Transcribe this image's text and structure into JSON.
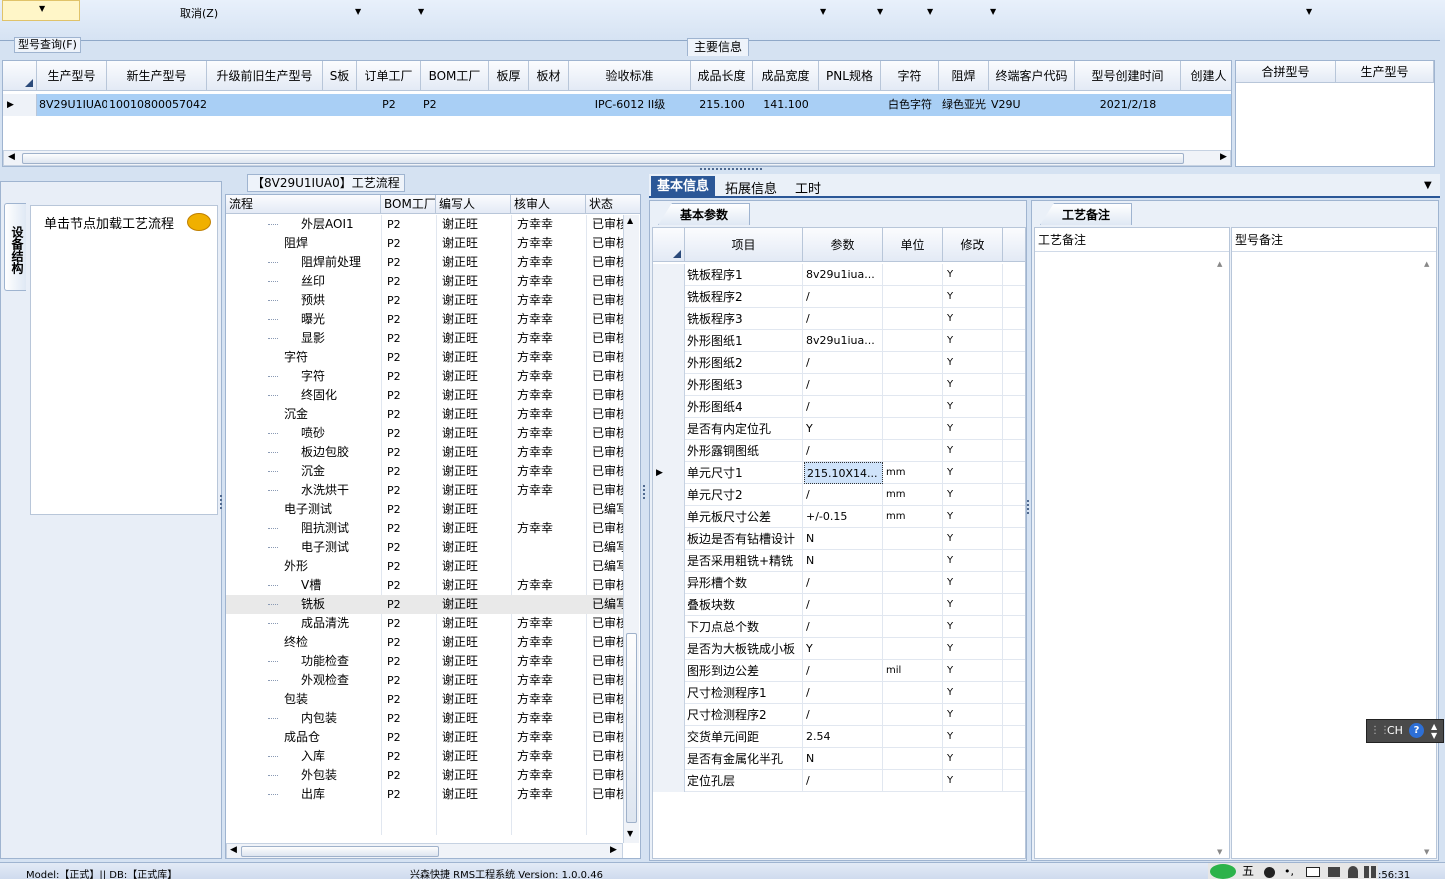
{
  "menu": {
    "cancel_label": "取消(Z)"
  },
  "top_panel": {
    "title": "型号查询(F)",
    "main_tab": "主要信息"
  },
  "model_table": {
    "headers": [
      "生产型号",
      "新生产型号",
      "升级前旧生产型号",
      "S板",
      "订单工厂",
      "BOM工厂",
      "板厚",
      "板材",
      "验收标准",
      "成品长度",
      "成品宽度",
      "PNL规格",
      "字符",
      "阻焊",
      "终端客户代码",
      "型号创建时间",
      "创建人"
    ],
    "row": [
      "8V29U1IUA0",
      "10010800057042",
      "",
      "",
      "P2",
      "P2",
      "",
      "",
      "IPC-6012 II级",
      "215.100",
      "141.100",
      "",
      "白色字符",
      "绿色亚光",
      "V29U",
      "2021/2/18",
      ""
    ]
  },
  "side_table": {
    "headers": [
      "合拼型号",
      "生产型号"
    ]
  },
  "left_panel": {
    "vertical_tab": "设备结构",
    "hint": "单击节点加载工艺流程"
  },
  "flow_panel": {
    "title": "【8V29U1IUA0】工艺流程",
    "headers": [
      "流程",
      "BOM工厂",
      "编写人",
      "核审人",
      "状态"
    ],
    "rows": [
      {
        "level": 2,
        "type": "doc",
        "name": "外层AOI1",
        "bom": "P2",
        "writer": "谢正旺",
        "reviewer": "方幸幸",
        "status": "已审核"
      },
      {
        "level": 1,
        "type": "folder",
        "name": "阻焊",
        "bom": "P2",
        "writer": "谢正旺",
        "reviewer": "方幸幸",
        "status": "已审核"
      },
      {
        "level": 2,
        "type": "doc",
        "name": "阻焊前处理",
        "bom": "P2",
        "writer": "谢正旺",
        "reviewer": "方幸幸",
        "status": "已审核"
      },
      {
        "level": 2,
        "type": "doc",
        "name": "丝印",
        "bom": "P2",
        "writer": "谢正旺",
        "reviewer": "方幸幸",
        "status": "已审核"
      },
      {
        "level": 2,
        "type": "doc",
        "name": "预烘",
        "bom": "P2",
        "writer": "谢正旺",
        "reviewer": "方幸幸",
        "status": "已审核"
      },
      {
        "level": 2,
        "type": "doc",
        "name": "曝光",
        "bom": "P2",
        "writer": "谢正旺",
        "reviewer": "方幸幸",
        "status": "已审核"
      },
      {
        "level": 2,
        "type": "doc",
        "name": "显影",
        "bom": "P2",
        "writer": "谢正旺",
        "reviewer": "方幸幸",
        "status": "已审核"
      },
      {
        "level": 1,
        "type": "folder",
        "name": "字符",
        "bom": "P2",
        "writer": "谢正旺",
        "reviewer": "方幸幸",
        "status": "已审核"
      },
      {
        "level": 2,
        "type": "doc",
        "name": "字符",
        "bom": "P2",
        "writer": "谢正旺",
        "reviewer": "方幸幸",
        "status": "已审核"
      },
      {
        "level": 2,
        "type": "doc",
        "name": "终固化",
        "bom": "P2",
        "writer": "谢正旺",
        "reviewer": "方幸幸",
        "status": "已审核"
      },
      {
        "level": 1,
        "type": "folder",
        "name": "沉金",
        "bom": "P2",
        "writer": "谢正旺",
        "reviewer": "方幸幸",
        "status": "已审核"
      },
      {
        "level": 2,
        "type": "doc",
        "name": "喷砂",
        "bom": "P2",
        "writer": "谢正旺",
        "reviewer": "方幸幸",
        "status": "已审核"
      },
      {
        "level": 2,
        "type": "doc",
        "name": "板边包胶",
        "bom": "P2",
        "writer": "谢正旺",
        "reviewer": "方幸幸",
        "status": "已审核"
      },
      {
        "level": 2,
        "type": "doc",
        "name": "沉金",
        "bom": "P2",
        "writer": "谢正旺",
        "reviewer": "方幸幸",
        "status": "已审核"
      },
      {
        "level": 2,
        "type": "doc",
        "name": "水洗烘干",
        "bom": "P2",
        "writer": "谢正旺",
        "reviewer": "方幸幸",
        "status": "已审核"
      },
      {
        "level": 1,
        "type": "folder",
        "name": "电子测试",
        "bom": "P2",
        "writer": "谢正旺",
        "reviewer": "",
        "status": "已编写"
      },
      {
        "level": 2,
        "type": "doc",
        "name": "阻抗测试",
        "bom": "P2",
        "writer": "谢正旺",
        "reviewer": "方幸幸",
        "status": "已审核"
      },
      {
        "level": 2,
        "type": "doc",
        "name": "电子测试",
        "bom": "P2",
        "writer": "谢正旺",
        "reviewer": "",
        "status": "已编写"
      },
      {
        "level": 1,
        "type": "folder",
        "name": "外形",
        "bom": "P2",
        "writer": "谢正旺",
        "reviewer": "",
        "status": "已编写"
      },
      {
        "level": 2,
        "type": "doc",
        "name": "V槽",
        "bom": "P2",
        "writer": "谢正旺",
        "reviewer": "方幸幸",
        "status": "已审核"
      },
      {
        "level": 2,
        "type": "doc",
        "name": "铣板",
        "bom": "P2",
        "writer": "谢正旺",
        "reviewer": "",
        "status": "已编写",
        "selected": true
      },
      {
        "level": 2,
        "type": "doc",
        "name": "成品清洗",
        "bom": "P2",
        "writer": "谢正旺",
        "reviewer": "方幸幸",
        "status": "已审核"
      },
      {
        "level": 1,
        "type": "folder",
        "name": "终检",
        "bom": "P2",
        "writer": "谢正旺",
        "reviewer": "方幸幸",
        "status": "已审核"
      },
      {
        "level": 2,
        "type": "doc",
        "name": "功能检查",
        "bom": "P2",
        "writer": "谢正旺",
        "reviewer": "方幸幸",
        "status": "已审核"
      },
      {
        "level": 2,
        "type": "doc",
        "name": "外观检查",
        "bom": "P2",
        "writer": "谢正旺",
        "reviewer": "方幸幸",
        "status": "已审核"
      },
      {
        "level": 1,
        "type": "folder",
        "name": "包装",
        "bom": "P2",
        "writer": "谢正旺",
        "reviewer": "方幸幸",
        "status": "已审核"
      },
      {
        "level": 2,
        "type": "doc",
        "name": "内包装",
        "bom": "P2",
        "writer": "谢正旺",
        "reviewer": "方幸幸",
        "status": "已审核"
      },
      {
        "level": 1,
        "type": "folder",
        "name": "成品仓",
        "bom": "P2",
        "writer": "谢正旺",
        "reviewer": "方幸幸",
        "status": "已审核"
      },
      {
        "level": 2,
        "type": "doc",
        "name": "入库",
        "bom": "P2",
        "writer": "谢正旺",
        "reviewer": "方幸幸",
        "status": "已审核"
      },
      {
        "level": 2,
        "type": "doc",
        "name": "外包装",
        "bom": "P2",
        "writer": "谢正旺",
        "reviewer": "方幸幸",
        "status": "已审核"
      },
      {
        "level": 2,
        "type": "doc",
        "name": "出库",
        "bom": "P2",
        "writer": "谢正旺",
        "reviewer": "方幸幸",
        "status": "已审核"
      }
    ]
  },
  "detail_tabs": [
    "基本信息",
    "拓展信息",
    "工时"
  ],
  "params_panel": {
    "tab": "基本参数",
    "headers": [
      "项目",
      "参数",
      "单位",
      "修改"
    ],
    "rows": [
      {
        "item": "铣板程序1",
        "param": "8v29u1iua...",
        "unit": "",
        "mod": "Y"
      },
      {
        "item": "铣板程序2",
        "param": "/",
        "unit": "",
        "mod": "Y"
      },
      {
        "item": "铣板程序3",
        "param": "/",
        "unit": "",
        "mod": "Y"
      },
      {
        "item": "外形图纸1",
        "param": "8v29u1iua...",
        "unit": "",
        "mod": "Y"
      },
      {
        "item": "外形图纸2",
        "param": "/",
        "unit": "",
        "mod": "Y"
      },
      {
        "item": "外形图纸3",
        "param": "/",
        "unit": "",
        "mod": "Y"
      },
      {
        "item": "外形图纸4",
        "param": "/",
        "unit": "",
        "mod": "Y"
      },
      {
        "item": "是否有内定位孔",
        "param": "Y",
        "unit": "",
        "mod": "Y"
      },
      {
        "item": "外形露铜图纸",
        "param": "/",
        "unit": "",
        "mod": "Y"
      },
      {
        "item": "单元尺寸1",
        "param": "215.10X14...",
        "unit": "mm",
        "mod": "Y",
        "current": true
      },
      {
        "item": "单元尺寸2",
        "param": "/",
        "unit": "mm",
        "mod": "Y"
      },
      {
        "item": "单元板尺寸公差",
        "param": "+/-0.15",
        "unit": "mm",
        "mod": "Y"
      },
      {
        "item": "板边是否有钻槽设计",
        "param": "N",
        "unit": "",
        "mod": "Y"
      },
      {
        "item": "是否采用粗铣+精铣",
        "param": "N",
        "unit": "",
        "mod": "Y"
      },
      {
        "item": "异形槽个数",
        "param": "/",
        "unit": "",
        "mod": "Y"
      },
      {
        "item": "叠板块数",
        "param": "/",
        "unit": "",
        "mod": "Y"
      },
      {
        "item": "下刀点总个数",
        "param": "/",
        "unit": "",
        "mod": "Y"
      },
      {
        "item": "是否为大板铣成小板",
        "param": "Y",
        "unit": "",
        "mod": "Y"
      },
      {
        "item": "图形到边公差",
        "param": "/",
        "unit": "mil",
        "mod": "Y"
      },
      {
        "item": "尺寸检测程序1",
        "param": "/",
        "unit": "",
        "mod": "Y"
      },
      {
        "item": "尺寸检测程序2",
        "param": "/",
        "unit": "",
        "mod": "Y"
      },
      {
        "item": "交货单元间距",
        "param": "2.54",
        "unit": "",
        "mod": "Y"
      },
      {
        "item": "是否有金属化半孔",
        "param": "N",
        "unit": "",
        "mod": "Y"
      },
      {
        "item": "定位孔层",
        "param": "/",
        "unit": "",
        "mod": "Y"
      }
    ]
  },
  "notes_panel": {
    "tab": "工艺备注",
    "col1": "工艺备注",
    "col2": "型号备注"
  },
  "ime_bar": {
    "label": "CH"
  },
  "status_bar": {
    "text": "Model:【正式】|| DB:【正式库】",
    "version": "兴森快捷 RMS工程系统 Version: 1.0.0.46",
    "clock": ":56:31"
  }
}
